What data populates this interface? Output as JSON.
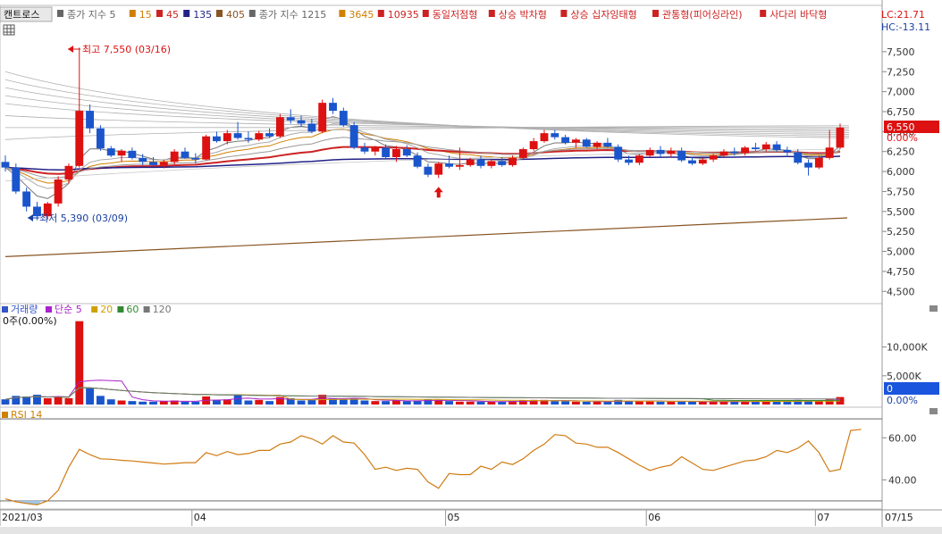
{
  "legend": {
    "chart_name": "캔트로스",
    "items": [
      {
        "text": "종가 지수 5",
        "color": "#666666"
      },
      {
        "text": "15",
        "color": "#d08000"
      },
      {
        "text": "45",
        "color": "#cc2222"
      },
      {
        "text": "135",
        "color": "#222288"
      },
      {
        "text": "405",
        "color": "#885522"
      },
      {
        "text": "종가 지수 1215",
        "color": "#666666"
      },
      {
        "text": "3645",
        "color": "#d08000"
      },
      {
        "text": "10935",
        "color": "#cc2222"
      }
    ],
    "patterns": [
      "동일저점형",
      "상승 박차형",
      "상승 십자잉태형",
      "관통형(피어싱라인)",
      "사다리 바닥형"
    ]
  },
  "corner": {
    "lc": "LC:21.71",
    "hc": "HC:-13.11"
  },
  "annotations": {
    "high": "최고 7,550 (03/16)",
    "low": "최저 5,390 (03/09)"
  },
  "price_axis": {
    "ticks": [
      "7,500",
      "7,250",
      "7,000",
      "6,750",
      "6,500",
      "6,250",
      "6,000",
      "5,750",
      "5,500",
      "5,250",
      "5,000",
      "4,750",
      "4,500"
    ],
    "current_price": "6,550",
    "current_change": "0.00%"
  },
  "volume_panel": {
    "legend": [
      {
        "text": "거래량",
        "color": "#3355cc"
      },
      {
        "text": "단순 5",
        "color": "#aa22cc"
      },
      {
        "text": "20",
        "color": "#d0a000"
      },
      {
        "text": "60",
        "color": "#338833"
      },
      {
        "text": "120",
        "color": "#777777"
      }
    ],
    "value_text": "0주(0.00%)",
    "ticks": [
      "10,000K",
      "5,000K"
    ],
    "current_value": "0",
    "current_pct": "0.00%"
  },
  "rsi_panel": {
    "label": "RSI 14",
    "ticks": [
      "60.00",
      "40.00"
    ]
  },
  "date_axis": {
    "labels": [
      "2021/03",
      "04",
      "05",
      "06",
      "07"
    ],
    "right_label": "07/15"
  },
  "chart_data": {
    "type": "candlestick",
    "period": "2021/03 – 2021/07/15",
    "price": {
      "ylim": [
        4380,
        7700
      ],
      "ticks": [
        7500,
        7250,
        7000,
        6750,
        6500,
        6250,
        6000,
        5750,
        5500,
        5250,
        5000,
        4750,
        4500
      ],
      "last_close": 6550,
      "high": 7550,
      "low": 5390,
      "candles": [
        {
          "o": 6120,
          "h": 6200,
          "l": 6000,
          "c": 6050,
          "v": 900
        },
        {
          "o": 6050,
          "h": 6100,
          "l": 5720,
          "c": 5750,
          "v": 1500
        },
        {
          "o": 5750,
          "h": 5800,
          "l": 5500,
          "c": 5560,
          "v": 1400
        },
        {
          "o": 5560,
          "h": 5620,
          "l": 5390,
          "c": 5440,
          "v": 1700
        },
        {
          "o": 5440,
          "h": 5620,
          "l": 5400,
          "c": 5600,
          "v": 1100
        },
        {
          "o": 5600,
          "h": 5940,
          "l": 5560,
          "c": 5900,
          "v": 1300
        },
        {
          "o": 5900,
          "h": 6100,
          "l": 5850,
          "c": 6070,
          "v": 1100
        },
        {
          "o": 6070,
          "h": 7550,
          "l": 6050,
          "c": 6760,
          "v": 14500
        },
        {
          "o": 6760,
          "h": 6840,
          "l": 6480,
          "c": 6540,
          "v": 2800
        },
        {
          "o": 6540,
          "h": 6580,
          "l": 6260,
          "c": 6290,
          "v": 1500
        },
        {
          "o": 6290,
          "h": 6320,
          "l": 6180,
          "c": 6200,
          "v": 900
        },
        {
          "o": 6200,
          "h": 6280,
          "l": 6120,
          "c": 6260,
          "v": 700
        },
        {
          "o": 6260,
          "h": 6300,
          "l": 6150,
          "c": 6170,
          "v": 600
        },
        {
          "o": 6170,
          "h": 6220,
          "l": 6080,
          "c": 6120,
          "v": 500
        },
        {
          "o": 6120,
          "h": 6180,
          "l": 6060,
          "c": 6080,
          "v": 500
        },
        {
          "o": 6080,
          "h": 6150,
          "l": 6040,
          "c": 6120,
          "v": 600
        },
        {
          "o": 6120,
          "h": 6280,
          "l": 6090,
          "c": 6250,
          "v": 700
        },
        {
          "o": 6250,
          "h": 6300,
          "l": 6160,
          "c": 6170,
          "v": 500
        },
        {
          "o": 6170,
          "h": 6230,
          "l": 6100,
          "c": 6150,
          "v": 500
        },
        {
          "o": 6150,
          "h": 6460,
          "l": 6140,
          "c": 6440,
          "v": 1400
        },
        {
          "o": 6440,
          "h": 6500,
          "l": 6360,
          "c": 6380,
          "v": 800
        },
        {
          "o": 6380,
          "h": 6520,
          "l": 6340,
          "c": 6480,
          "v": 900
        },
        {
          "o": 6480,
          "h": 6620,
          "l": 6400,
          "c": 6420,
          "v": 1700
        },
        {
          "o": 6420,
          "h": 6500,
          "l": 6360,
          "c": 6400,
          "v": 700
        },
        {
          "o": 6400,
          "h": 6510,
          "l": 6380,
          "c": 6480,
          "v": 800
        },
        {
          "o": 6480,
          "h": 6540,
          "l": 6420,
          "c": 6440,
          "v": 600
        },
        {
          "o": 6440,
          "h": 6720,
          "l": 6420,
          "c": 6680,
          "v": 1300
        },
        {
          "o": 6680,
          "h": 6780,
          "l": 6600,
          "c": 6640,
          "v": 1100
        },
        {
          "o": 6640,
          "h": 6700,
          "l": 6560,
          "c": 6600,
          "v": 700
        },
        {
          "o": 6600,
          "h": 6660,
          "l": 6480,
          "c": 6500,
          "v": 800
        },
        {
          "o": 6500,
          "h": 6900,
          "l": 6480,
          "c": 6860,
          "v": 1700
        },
        {
          "o": 6860,
          "h": 6920,
          "l": 6720,
          "c": 6760,
          "v": 1000
        },
        {
          "o": 6760,
          "h": 6800,
          "l": 6560,
          "c": 6580,
          "v": 900
        },
        {
          "o": 6580,
          "h": 6620,
          "l": 6280,
          "c": 6300,
          "v": 1000
        },
        {
          "o": 6300,
          "h": 6360,
          "l": 6220,
          "c": 6250,
          "v": 700
        },
        {
          "o": 6250,
          "h": 6320,
          "l": 6200,
          "c": 6300,
          "v": 600
        },
        {
          "o": 6300,
          "h": 6340,
          "l": 6160,
          "c": 6180,
          "v": 600
        },
        {
          "o": 6180,
          "h": 6320,
          "l": 6120,
          "c": 6280,
          "v": 700
        },
        {
          "o": 6280,
          "h": 6330,
          "l": 6180,
          "c": 6200,
          "v": 600
        },
        {
          "o": 6200,
          "h": 6240,
          "l": 6040,
          "c": 6060,
          "v": 700
        },
        {
          "o": 6060,
          "h": 6100,
          "l": 5930,
          "c": 5960,
          "v": 900
        },
        {
          "o": 5960,
          "h": 6120,
          "l": 5920,
          "c": 6100,
          "v": 800
        },
        {
          "o": 6100,
          "h": 6200,
          "l": 6040,
          "c": 6060,
          "v": 600
        },
        {
          "o": 6060,
          "h": 6300,
          "l": 6020,
          "c": 6080,
          "v": 500
        },
        {
          "o": 6080,
          "h": 6170,
          "l": 6060,
          "c": 6150,
          "v": 500
        },
        {
          "o": 6150,
          "h": 6200,
          "l": 6040,
          "c": 6070,
          "v": 500
        },
        {
          "o": 6070,
          "h": 6150,
          "l": 6040,
          "c": 6130,
          "v": 500
        },
        {
          "o": 6130,
          "h": 6180,
          "l": 6060,
          "c": 6080,
          "v": 500
        },
        {
          "o": 6080,
          "h": 6200,
          "l": 6060,
          "c": 6170,
          "v": 600
        },
        {
          "o": 6170,
          "h": 6300,
          "l": 6150,
          "c": 6280,
          "v": 700
        },
        {
          "o": 6280,
          "h": 6420,
          "l": 6260,
          "c": 6380,
          "v": 800
        },
        {
          "o": 6380,
          "h": 6520,
          "l": 6360,
          "c": 6480,
          "v": 800
        },
        {
          "o": 6480,
          "h": 6520,
          "l": 6400,
          "c": 6430,
          "v": 600
        },
        {
          "o": 6430,
          "h": 6460,
          "l": 6340,
          "c": 6360,
          "v": 600
        },
        {
          "o": 6360,
          "h": 6420,
          "l": 6300,
          "c": 6400,
          "v": 500
        },
        {
          "o": 6400,
          "h": 6420,
          "l": 6300,
          "c": 6310,
          "v": 500
        },
        {
          "o": 6310,
          "h": 6380,
          "l": 6280,
          "c": 6360,
          "v": 500
        },
        {
          "o": 6360,
          "h": 6420,
          "l": 6300,
          "c": 6310,
          "v": 500
        },
        {
          "o": 6310,
          "h": 6340,
          "l": 6120,
          "c": 6150,
          "v": 800
        },
        {
          "o": 6150,
          "h": 6200,
          "l": 6080,
          "c": 6110,
          "v": 600
        },
        {
          "o": 6110,
          "h": 6220,
          "l": 6080,
          "c": 6200,
          "v": 600
        },
        {
          "o": 6200,
          "h": 6300,
          "l": 6180,
          "c": 6270,
          "v": 600
        },
        {
          "o": 6270,
          "h": 6320,
          "l": 6180,
          "c": 6220,
          "v": 500
        },
        {
          "o": 6220,
          "h": 6300,
          "l": 6180,
          "c": 6260,
          "v": 500
        },
        {
          "o": 6260,
          "h": 6300,
          "l": 6120,
          "c": 6140,
          "v": 600
        },
        {
          "o": 6140,
          "h": 6180,
          "l": 6080,
          "c": 6100,
          "v": 500
        },
        {
          "o": 6100,
          "h": 6170,
          "l": 6080,
          "c": 6150,
          "v": 500
        },
        {
          "o": 6150,
          "h": 6220,
          "l": 6120,
          "c": 6200,
          "v": 500
        },
        {
          "o": 6200,
          "h": 6280,
          "l": 6180,
          "c": 6250,
          "v": 500
        },
        {
          "o": 6250,
          "h": 6300,
          "l": 6200,
          "c": 6230,
          "v": 500
        },
        {
          "o": 6230,
          "h": 6320,
          "l": 6200,
          "c": 6300,
          "v": 600
        },
        {
          "o": 6300,
          "h": 6360,
          "l": 6260,
          "c": 6280,
          "v": 500
        },
        {
          "o": 6280,
          "h": 6370,
          "l": 6250,
          "c": 6340,
          "v": 600
        },
        {
          "o": 6340,
          "h": 6380,
          "l": 6250,
          "c": 6270,
          "v": 500
        },
        {
          "o": 6270,
          "h": 6310,
          "l": 6200,
          "c": 6240,
          "v": 500
        },
        {
          "o": 6240,
          "h": 6280,
          "l": 6090,
          "c": 6110,
          "v": 800
        },
        {
          "o": 6110,
          "h": 6150,
          "l": 5950,
          "c": 6050,
          "v": 700
        },
        {
          "o": 6050,
          "h": 6200,
          "l": 6030,
          "c": 6170,
          "v": 600
        },
        {
          "o": 6170,
          "h": 6520,
          "l": 6150,
          "c": 6300,
          "v": 900
        },
        {
          "o": 6300,
          "h": 6600,
          "l": 6280,
          "c": 6550,
          "v": 1300
        }
      ],
      "markers": [
        {
          "index": 41,
          "type": "up-arrow",
          "color": "#dd1111"
        }
      ]
    },
    "volume": {
      "unit": "K",
      "ylim": [
        0,
        16000
      ],
      "ticks": [
        10000,
        5000
      ]
    },
    "rsi": {
      "period": 14,
      "ylim": [
        27,
        72
      ],
      "ticks": [
        60,
        40
      ],
      "lines": [
        69,
        30
      ],
      "values": [
        31,
        29.6,
        28.8,
        28.2,
        30,
        35,
        46,
        54.5,
        52,
        50,
        49.8,
        49.3,
        49,
        48.5,
        48,
        47.5,
        47.8,
        48.2,
        48.2,
        53,
        51.5,
        53.5,
        52,
        52.5,
        54,
        54,
        57,
        58,
        61,
        59.5,
        57,
        61,
        58,
        57.5,
        52,
        45,
        46,
        44.5,
        45.5,
        45,
        39,
        36,
        43,
        42.5,
        42.5,
        46.5,
        45,
        48.5,
        47.3,
        50,
        54,
        57,
        61.5,
        61,
        57.5,
        57,
        55.5,
        55.5,
        53,
        50,
        47,
        44.5,
        46,
        47,
        51,
        48,
        45,
        44.5,
        46,
        47.5,
        49,
        49.5,
        51,
        54,
        53,
        55,
        58.5,
        53,
        44,
        45,
        63.5,
        64
      ]
    }
  }
}
